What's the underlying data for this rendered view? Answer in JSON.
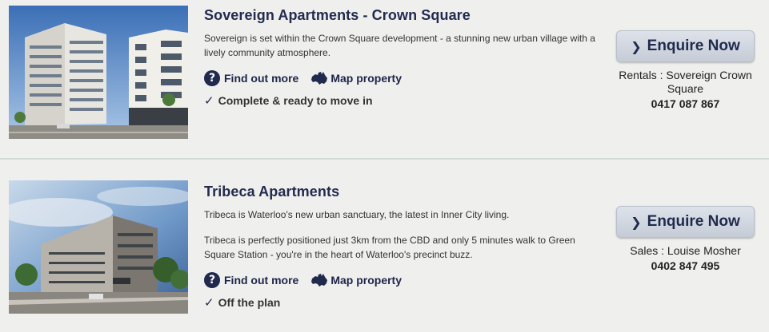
{
  "listings": [
    {
      "title": "Sovereign Apartments - Crown Square",
      "descriptions": [
        "Sovereign is set within the Crown Square development - a stunning new urban village with a lively community atmosphere."
      ],
      "find_out_more": "Find out more",
      "map_property": "Map property",
      "status": "Complete & ready to move in",
      "enquire_label": "Enquire Now",
      "contact": "Rentals : Sovereign Crown Square",
      "phone": "0417 087 867"
    },
    {
      "title": "Tribeca Apartments",
      "descriptions": [
        "Tribeca is Waterloo's new urban sanctuary, the latest in Inner City living.",
        "Tribeca is perfectly positioned just 3km from the CBD and only 5 minutes walk to Green Square Station - you're in the heart of Waterloo's precinct buzz."
      ],
      "find_out_more": "Find out more",
      "map_property": "Map property",
      "status": "Off the plan",
      "enquire_label": "Enquire Now",
      "contact": "Sales : Louise Mosher",
      "phone": "0402 847 495"
    }
  ],
  "icons": {
    "info": "question-circle-icon",
    "map": "australia-map-icon",
    "status": "checkmark-icon",
    "enquire": "chevron-right-icon"
  },
  "colors": {
    "title": "#232b4e",
    "button_bg": "#d3d8e0",
    "icon": "#1f2a4d",
    "background": "#efefee"
  }
}
